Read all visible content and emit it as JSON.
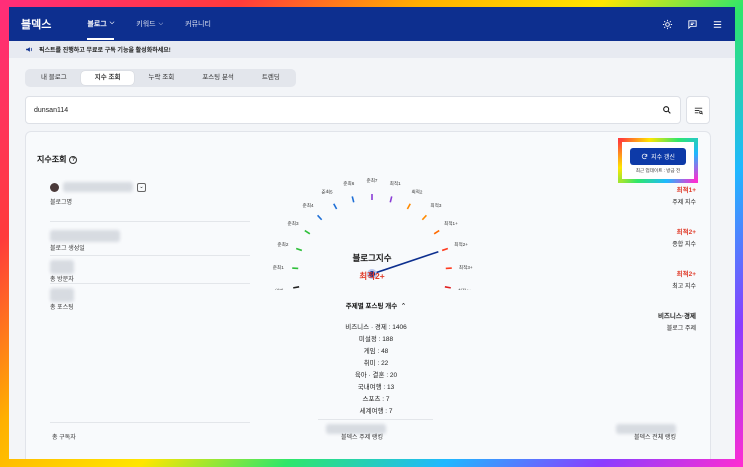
{
  "header": {
    "brand": "블덱스",
    "nav": [
      {
        "label": "블로그",
        "active": true
      },
      {
        "label": "키워드",
        "active": false
      },
      {
        "label": "커뮤니티",
        "active": false
      }
    ]
  },
  "notice": {
    "text": "픽스트를 진행하고 무료로 구독 기능을 활성화하세요!"
  },
  "tabs": [
    "내 블로그",
    "지수 조회",
    "누락 조회",
    "포스팅 분석",
    "트렌딩"
  ],
  "active_tab": 1,
  "search": {
    "value": "dunsan114"
  },
  "card": {
    "title": "지수조회",
    "refresh_label": "지수 갱신",
    "updated_text": "최근 업데이트 : 방금 전",
    "left": {
      "blog_name_label": "블로그명",
      "created_label": "블로그 생성일",
      "visitors_label": "총 방문자",
      "posts_label": "총 포스팅",
      "subscribers_label": "총 구독자"
    },
    "right": [
      {
        "value": "최적1+",
        "label": "주제 지수",
        "red": true
      },
      {
        "value": "최적2+",
        "label": "종합 지수",
        "red": true
      },
      {
        "value": "최적2+",
        "label": "최고 지수",
        "red": true
      },
      {
        "value": "비즈니스·경제",
        "label": "블로그 주제",
        "red": false
      }
    ],
    "gauge": {
      "title": "블로그지수",
      "value": "최적2+",
      "labels": [
        "일반",
        "준최1",
        "준최2",
        "준최3",
        "준최4",
        "준최5",
        "준최6",
        "준최7",
        "최적1",
        "최적2",
        "최적3",
        "최적1+",
        "최적2+",
        "최적3+",
        "최적4+"
      ],
      "needle_index": 12
    },
    "topic": {
      "header": "주제별 포스팅 개수",
      "items": [
        "비즈니스 · 경제 : 1406",
        "미설정 : 188",
        "게임 : 48",
        "취미 : 22",
        "육아 · 결혼 : 20",
        "국내여행 : 13",
        "스포츠 : 7",
        "세계여행 : 7"
      ]
    },
    "bottom": {
      "topic_rank_label": "블덱스 주제 랭킹",
      "overall_rank_label": "블덱스 전체 랭킹"
    }
  }
}
